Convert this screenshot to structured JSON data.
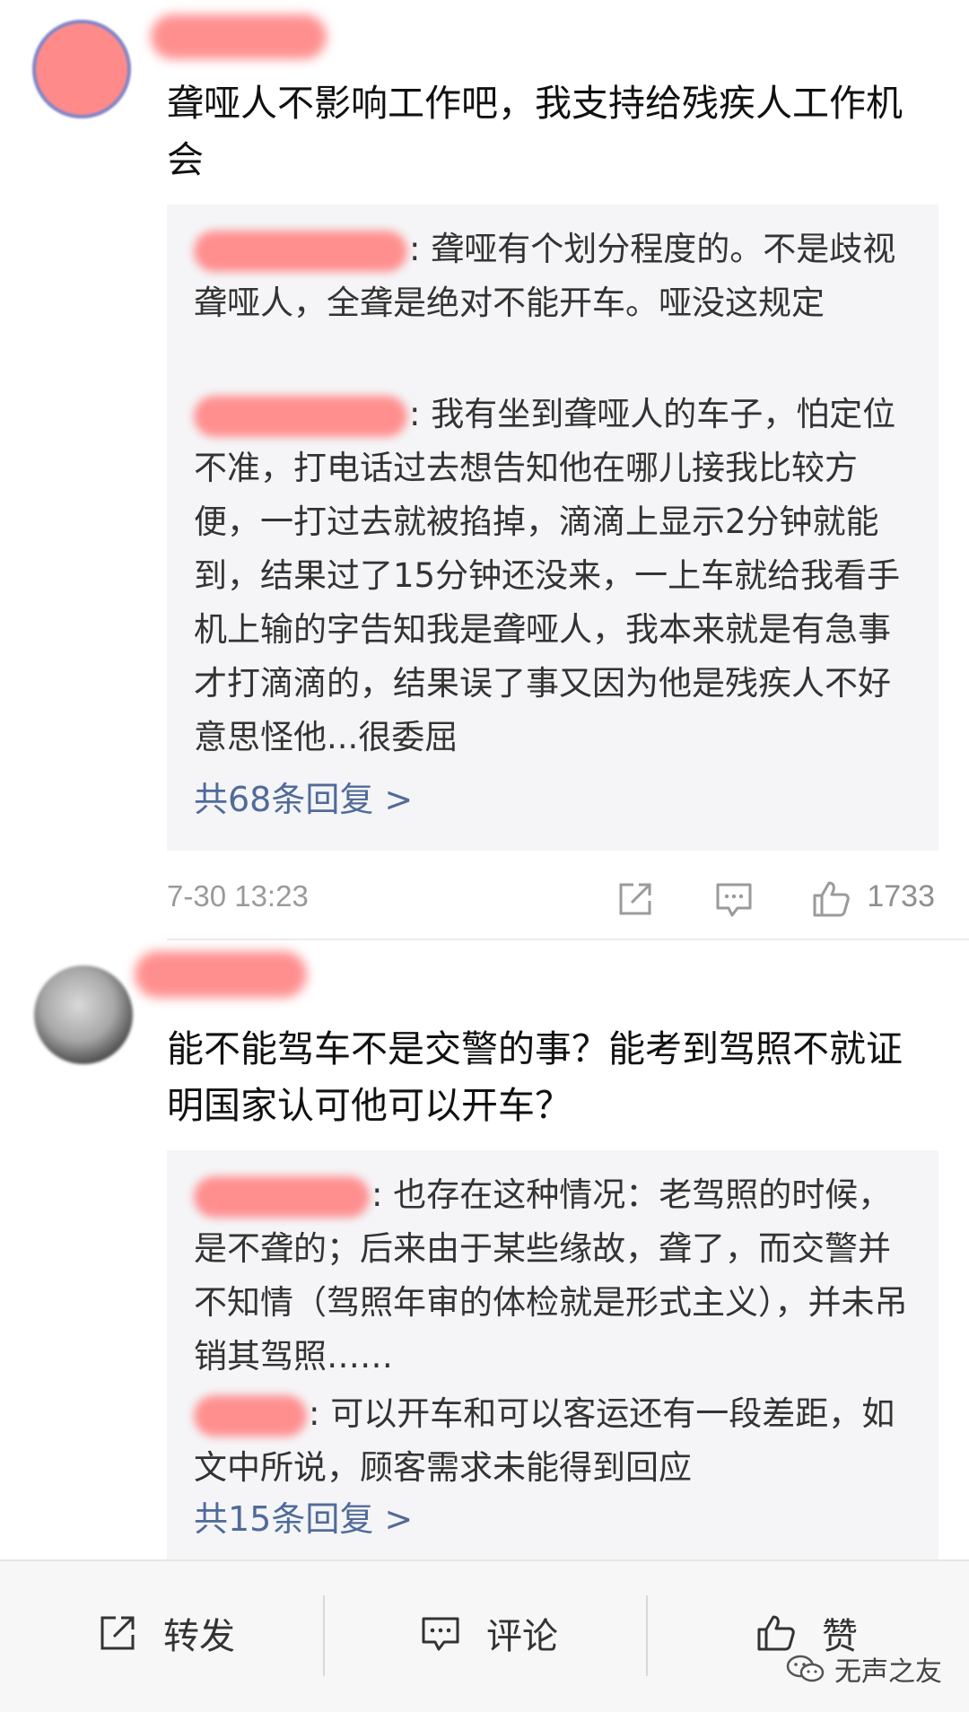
{
  "comments": [
    {
      "text": "聋哑人不影响工作吧，我支持给残疾人工作机会",
      "replies": [
        {
          "text": ": 聋哑有个划分程度的。不是歧视聋哑人，全聋是绝对不能开车。哑没这规定"
        },
        {
          "text": ": 我有坐到聋哑人的车子，怕定位不准，打电话过去想告知他在哪儿接我比较方便，一打过去就被掐掉，滴滴上显示2分钟就能到，结果过了15分钟还没来，一上车就给我看手机上输的字告知我是聋哑人，我本来就是有急事才打滴滴的，结果误了事又因为他是残疾人不好意思怪他...很委屈"
        }
      ],
      "more_replies": "共68条回复 >",
      "time": "7-30 13:23",
      "like_count": "1733"
    },
    {
      "text": "能不能驾车不是交警的事？能考到驾照不就证明国家认可他可以开车？",
      "replies": [
        {
          "text": ": 也存在这种情况：老驾照的时候，是不聋的；后来由于某些缘故，聋了，而交警并不知情（驾照年审的体检就是形式主义），并未吊销其驾照……"
        },
        {
          "text": ": 可以开车和可以客运还有一段差距，如文中所说，顾客需求未能得到回应"
        }
      ],
      "more_replies": "共15条回复 >"
    }
  ],
  "bottom_bar": {
    "repost_label": "转发",
    "comment_label": "评论",
    "like_label": "赞"
  },
  "watermark": "无声之友",
  "icons": {
    "repost": "share-arrow-icon",
    "comment": "comment-bubble-icon",
    "like": "thumbs-up-icon",
    "watermark": "wechat-icon"
  },
  "colors": {
    "link": "#506b99",
    "reply_background": "#f5f5f7",
    "redaction": "#ff8f8f"
  }
}
